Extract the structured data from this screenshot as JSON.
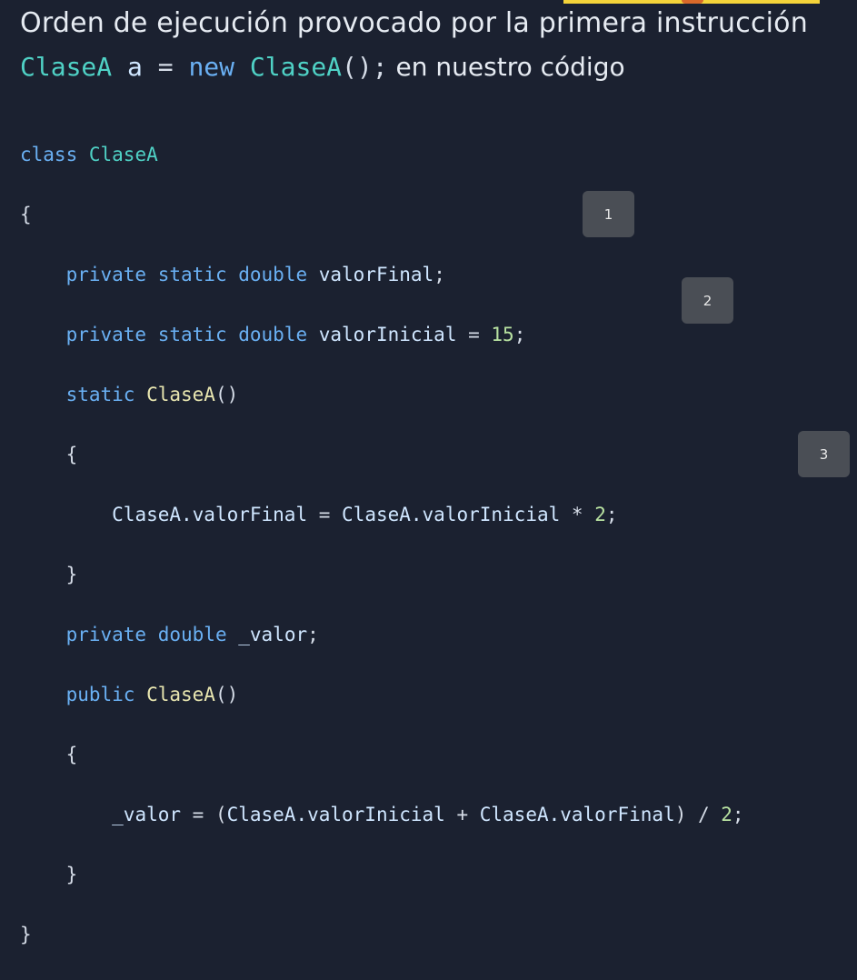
{
  "heading": {
    "line1": "Orden de ejecución provocado por la primera instrucción",
    "code_part1": "ClaseA",
    "code_part2": "a",
    "code_part3": "=",
    "code_part4": "new",
    "code_part5": "ClaseA",
    "code_part6": "();",
    "suffix": "en nuestro código"
  },
  "code": {
    "l1_kw": "class",
    "l1_ty": "ClaseA",
    "l2": "{",
    "l3_kw": "private static double",
    "l3_id": "valorFinal",
    "l3_end": ";",
    "l4_kw": "private static double",
    "l4_id": "valorInicial",
    "l4_eq": " = ",
    "l4_num": "15",
    "l4_end": ";",
    "l5_kw": "static",
    "l5_fn": "ClaseA",
    "l5_end": "()",
    "l6": "{",
    "l7_a": "ClaseA.valorFinal",
    "l7_eq": " = ",
    "l7_b": "ClaseA.valorInicial",
    "l7_op": " * ",
    "l7_num": "2",
    "l7_end": ";",
    "l8": "}",
    "l9_kw": "private double",
    "l9_id": "_valor",
    "l9_end": ";",
    "l10_kw": "public",
    "l10_fn": "ClaseA",
    "l10_end": "()",
    "l11": "{",
    "l12_a": "_valor",
    "l12_eq": " = (",
    "l12_b": "ClaseA.valorInicial",
    "l12_op": " + ",
    "l12_c": "ClaseA.valorFinal",
    "l12_div": ") / ",
    "l12_num": "2",
    "l12_end": ";",
    "l13": "}",
    "l14": "}"
  },
  "badges": [
    "1",
    "2",
    "3"
  ]
}
